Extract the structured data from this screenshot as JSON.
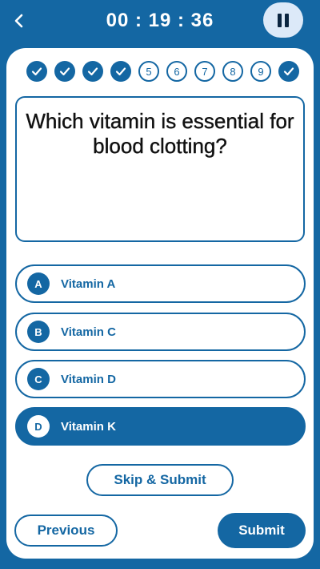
{
  "header": {
    "back_icon": "chevron-left-icon",
    "timer": "00 : 19 : 36",
    "pause_icon": "pause-icon",
    "pause_bg": "#dce9f8"
  },
  "colors": {
    "primary": "#1467a3",
    "background": "#1467a3",
    "card": "#ffffff",
    "question_text": "#111111"
  },
  "progress": {
    "steps": [
      {
        "label": "",
        "status": "done"
      },
      {
        "label": "",
        "status": "done"
      },
      {
        "label": "",
        "status": "done"
      },
      {
        "label": "",
        "status": "done"
      },
      {
        "label": "5",
        "status": "pending"
      },
      {
        "label": "6",
        "status": "pending"
      },
      {
        "label": "7",
        "status": "pending"
      },
      {
        "label": "8",
        "status": "pending"
      },
      {
        "label": "9",
        "status": "pending"
      },
      {
        "label": "",
        "status": "done"
      }
    ]
  },
  "question": {
    "text": "Which vitamin is essential for blood clotting?"
  },
  "options": [
    {
      "letter": "A",
      "label": "Vitamin A",
      "selected": false
    },
    {
      "letter": "B",
      "label": "Vitamin C",
      "selected": false
    },
    {
      "letter": "C",
      "label": "Vitamin D",
      "selected": false
    },
    {
      "letter": "D",
      "label": "Vitamin K",
      "selected": true
    }
  ],
  "actions": {
    "skip_label": "Skip & Submit",
    "previous_label": "Previous",
    "submit_label": "Submit"
  }
}
